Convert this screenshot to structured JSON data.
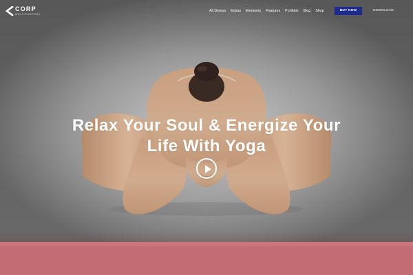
{
  "brand": {
    "name": "CORP",
    "tagline": "MULTIPURPOSE"
  },
  "nav": {
    "items": [
      {
        "label": "All Demos"
      },
      {
        "label": "Extras"
      },
      {
        "label": "Elements"
      },
      {
        "label": "Features"
      },
      {
        "label": "Portfolio"
      },
      {
        "label": "Blog"
      },
      {
        "label": "Shop"
      }
    ],
    "buy_label": "BUY NOW",
    "download_label": "DOWNLOAD"
  },
  "hero": {
    "title_line1": "Relax Your Soul & Energize Your",
    "title_line2": "Life With Yoga"
  },
  "colors": {
    "buy_button": "#1e2d8d",
    "bottom_band": "#c46c73"
  },
  "icons": {
    "play": "play-icon",
    "logo": "corp-logo-icon"
  }
}
